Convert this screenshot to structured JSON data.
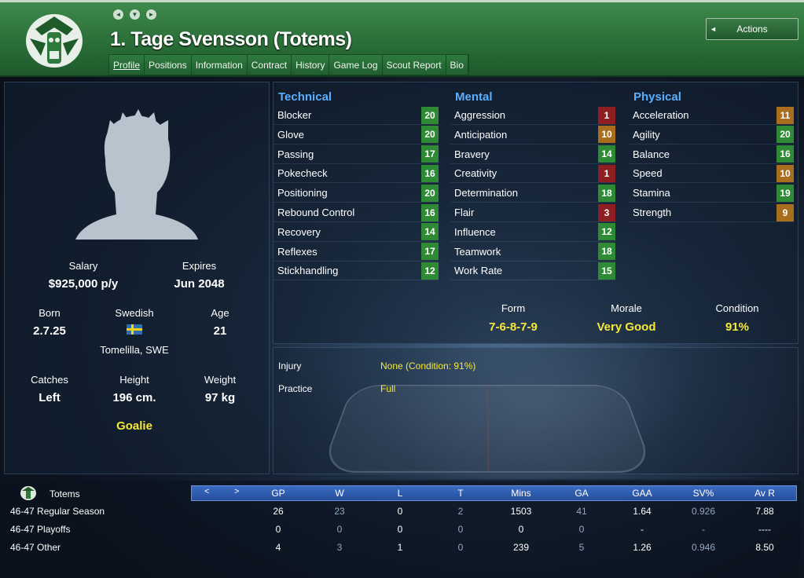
{
  "header": {
    "title": "1. Tage Svensson (Totems)",
    "tabs": [
      "Profile",
      "Positions",
      "Information",
      "Contract",
      "History",
      "Game Log",
      "Scout Report",
      "Bio"
    ],
    "actions_label": "Actions",
    "nav": [
      "◄",
      "▼",
      "►"
    ]
  },
  "profile": {
    "salary_label": "Salary",
    "salary": "$925,000 p/y",
    "expires_label": "Expires",
    "expires": "Jun 2048",
    "born_label": "Born",
    "born": "2.7.25",
    "nationality": "Swedish",
    "age_label": "Age",
    "age": "21",
    "hometown": "Tomelilla, SWE",
    "catches_label": "Catches",
    "catches": "Left",
    "height_label": "Height",
    "height": "196 cm.",
    "weight_label": "Weight",
    "weight": "97 kg",
    "position": "Goalie"
  },
  "attributes": {
    "technical": {
      "title": "Technical",
      "items": [
        [
          "Blocker",
          "20",
          "g"
        ],
        [
          "Glove",
          "20",
          "g"
        ],
        [
          "Passing",
          "17",
          "g"
        ],
        [
          "Pokecheck",
          "16",
          "g"
        ],
        [
          "Positioning",
          "20",
          "g"
        ],
        [
          "Rebound Control",
          "16",
          "g"
        ],
        [
          "Recovery",
          "14",
          "g"
        ],
        [
          "Reflexes",
          "17",
          "g"
        ],
        [
          "Stickhandling",
          "12",
          "g"
        ]
      ]
    },
    "mental": {
      "title": "Mental",
      "items": [
        [
          "Aggression",
          "1",
          "r"
        ],
        [
          "Anticipation",
          "10",
          "o"
        ],
        [
          "Bravery",
          "14",
          "g"
        ],
        [
          "Creativity",
          "1",
          "r"
        ],
        [
          "Determination",
          "18",
          "g"
        ],
        [
          "Flair",
          "3",
          "r"
        ],
        [
          "Influence",
          "12",
          "g"
        ],
        [
          "Teamwork",
          "18",
          "g"
        ],
        [
          "Work Rate",
          "15",
          "g"
        ]
      ]
    },
    "physical": {
      "title": "Physical",
      "items": [
        [
          "Acceleration",
          "11",
          "o"
        ],
        [
          "Agility",
          "20",
          "g"
        ],
        [
          "Balance",
          "16",
          "g"
        ],
        [
          "Speed",
          "10",
          "o"
        ],
        [
          "Stamina",
          "19",
          "g"
        ],
        [
          "Strength",
          "9",
          "o"
        ]
      ]
    }
  },
  "condition": {
    "form_label": "Form",
    "form": "7-6-8-7-9",
    "morale_label": "Morale",
    "morale": "Very Good",
    "condition_label": "Condition",
    "condition": "91%"
  },
  "injury": {
    "injury_label": "Injury",
    "injury": "None (Condition: 91%)",
    "practice_label": "Practice",
    "practice": "Full"
  },
  "stats": {
    "team": "Totems",
    "prev": "<",
    "next": ">",
    "columns": [
      "GP",
      "W",
      "L",
      "T",
      "Mins",
      "GA",
      "GAA",
      "SV%",
      "Av R"
    ],
    "rows": [
      {
        "label": "46-47 Regular Season",
        "values": [
          "26",
          "23",
          "0",
          "2",
          "1503",
          "41",
          "1.64",
          "0.926",
          "7.88"
        ]
      },
      {
        "label": "46-47 Playoffs",
        "values": [
          "0",
          "0",
          "0",
          "0",
          "0",
          "0",
          "-",
          "-",
          "----"
        ]
      },
      {
        "label": "46-47 Other",
        "values": [
          "4",
          "3",
          "1",
          "0",
          "239",
          "5",
          "1.26",
          "0.946",
          "8.50"
        ]
      }
    ]
  },
  "colors": {
    "green": "#2e8a34",
    "orange": "#a86e1e",
    "red": "#8f1e22",
    "accent": "#5ab0ff",
    "highlight": "#f5e93a"
  }
}
